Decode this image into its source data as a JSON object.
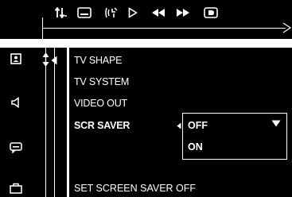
{
  "toolbar": {
    "icons": [
      "audio-sort-icon",
      "subtitle-icon",
      "angle-icon",
      "play-icon",
      "rewind-icon",
      "fast-forward-icon",
      "display-icon"
    ]
  },
  "sidebar": {
    "icons": [
      "setup-menu-icon",
      "speaker-icon",
      "subtitle-menu-icon",
      "tools-icon"
    ]
  },
  "menu": {
    "items": [
      {
        "label": "TV SHAPE"
      },
      {
        "label": "TV SYSTEM"
      },
      {
        "label": "VIDEO OUT"
      },
      {
        "label": "SCR SAVER"
      }
    ],
    "active_index": 3
  },
  "dropdown": {
    "options": [
      "OFF",
      "ON"
    ],
    "selected": "OFF"
  },
  "status": {
    "text": "SET SCREEN SAVER OFF"
  },
  "colors": {
    "background": "#000000",
    "foreground": "#ffffff",
    "frame": "#ffffff"
  }
}
